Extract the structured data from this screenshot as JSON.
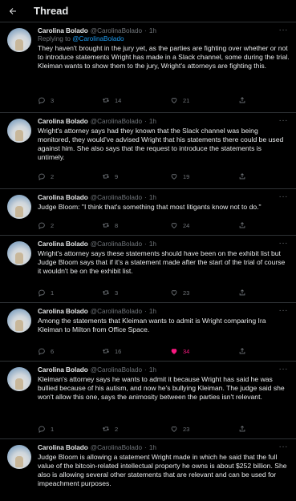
{
  "header": {
    "title": "Thread"
  },
  "author": {
    "name": "Carolina Bolado",
    "handle": "@CarolinaBolado",
    "time": "1h"
  },
  "tweets": [
    {
      "replying_prefix": "Replying to ",
      "replying_to": "@CarolinaBolado",
      "text": "They haven't brought in the jury yet, as the parties are fighting over whether or not to introduce statements Wright has made in a Slack channel, some during the trial. Kleiman wants to show them to the jury, Wright's attorneys are fighting this.",
      "replies": "3",
      "retweets": "14",
      "likes": "21"
    },
    {
      "text": "Wright's attorney says had they known that the Slack channel was being monitored, they would've advised Wright that his statements there could be used against him. She also says that the request to introduce the statements is untimely.",
      "replies": "2",
      "retweets": "9",
      "likes": "19"
    },
    {
      "text": "Judge Bloom: \"I think that's something that most litigants know not to do.\"",
      "replies": "2",
      "retweets": "8",
      "likes": "24"
    },
    {
      "text": "Wright's attorney says these statements should have been on the exhibit list but Judge Bloom says that if it's a statement made after the start of the trial of course it wouldn't be on the exhibit list.",
      "replies": "1",
      "retweets": "3",
      "likes": "23"
    },
    {
      "text": "Among the statements that Kleiman wants to admit is Wright comparing Ira Kleiman to Milton from Office Space.",
      "replies": "6",
      "retweets": "16",
      "likes": "34",
      "liked": true
    },
    {
      "text": "Kleiman's attorney says he wants to admit it because Wright has said he was bullied because of his autism, and now he's bullying Kleiman. The judge said she won't allow this one, says the animosity between the parties isn't relevant.",
      "replies": "1",
      "retweets": "2",
      "likes": "23"
    },
    {
      "text": "Judge Bloom is allowing a statement Wright made in which he said that the full value of the bitcoin-related intellectual property he owns is about $252 billion. She also is allowing several other statements that are relevant and can be used for impeachment purposes."
    }
  ],
  "colors": {
    "accent": "#1d9bf0",
    "like": "#f91880",
    "muted": "#71767b",
    "text": "#e7e9ea",
    "bg": "#000000"
  },
  "icons": {
    "back": "arrow-left-icon",
    "reply": "reply-icon",
    "retweet": "retweet-icon",
    "like": "heart-icon",
    "more": "more-icon"
  }
}
